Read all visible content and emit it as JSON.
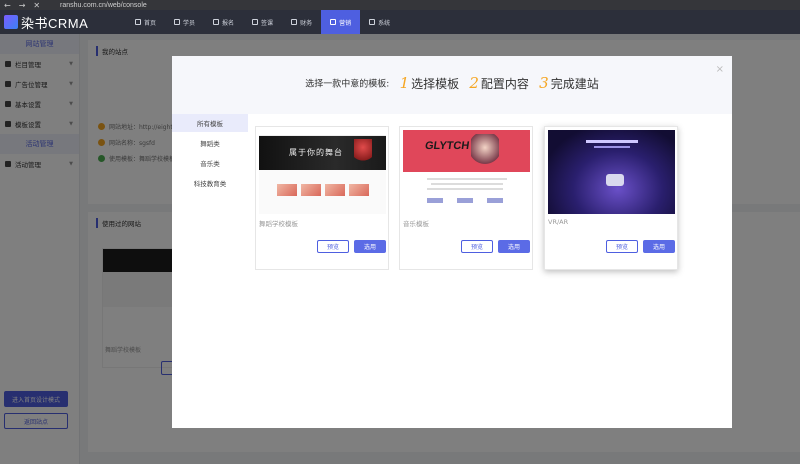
{
  "browser": {
    "back": "←",
    "forward": "→",
    "close": "✕",
    "url": "ranshu.com.cn/web/console"
  },
  "app": {
    "logo": "染书CRMA"
  },
  "topnav": {
    "items": [
      {
        "label": "首页"
      },
      {
        "label": "学员"
      },
      {
        "label": "报名"
      },
      {
        "label": "签课"
      },
      {
        "label": "财务"
      },
      {
        "label": "营销"
      },
      {
        "label": "系统"
      }
    ],
    "active_index": 5
  },
  "sidebar": {
    "section1": "网站管理",
    "items1": [
      {
        "label": "栏目管理"
      },
      {
        "label": "广告位管理"
      },
      {
        "label": "基本设置"
      },
      {
        "label": "模板设置"
      }
    ],
    "section2": "活动管理",
    "items2": [
      {
        "label": "活动管理"
      }
    ],
    "enter_design": "进入首页设计模式",
    "return_site": "返回站点"
  },
  "background": {
    "my_site_title": "我的站点",
    "site_address": "网站地址：http://eight.r",
    "site_name": "网站名称：sgsfd",
    "site_template": "使用模板：舞蹈学校模板",
    "used_sites_title": "使用过的网站",
    "used_card_name": "舞蹈学校模板"
  },
  "modal": {
    "close_icon": "×",
    "lead": "选择一款中意的模板:",
    "steps": [
      {
        "num": "1",
        "label": "选择模板"
      },
      {
        "num": "2",
        "label": "配置内容"
      },
      {
        "num": "3",
        "label": "完成建站"
      }
    ],
    "categories": [
      {
        "label": "所有模板"
      },
      {
        "label": "舞蹈类"
      },
      {
        "label": "音乐类"
      },
      {
        "label": "科技教育类"
      }
    ],
    "templates": [
      {
        "name": "舞蹈学校模板",
        "preview": "预览",
        "use": "选用",
        "banner_text": "属于你的舞台"
      },
      {
        "name": "音乐模板",
        "preview": "预览",
        "use": "选用",
        "banner_text": "GLYTCH"
      },
      {
        "name": "VR/AR",
        "preview": "预览",
        "use": "选用"
      }
    ]
  },
  "colors": {
    "accent": "#4e5fe0",
    "step_number": "#f5a623",
    "nav_bg": "#2c2f3a"
  }
}
